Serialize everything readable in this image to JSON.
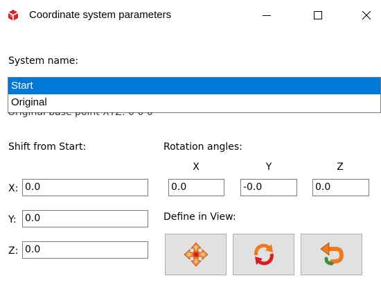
{
  "titlebar": {
    "title": "Coordinate system parameters",
    "app_icon": "sketchup-icon",
    "controls": [
      "minimize-icon",
      "maximize-icon",
      "close-icon"
    ]
  },
  "system": {
    "label": "System name:",
    "options": [
      "Start",
      "Original"
    ],
    "selected": "Start"
  },
  "base_point_label": "Original base point XYZ: 0 0 0",
  "shift": {
    "label": "Shift from Start:",
    "x_label": "X:",
    "x_value": "0.0",
    "y_label": "Y:",
    "y_value": "0.0",
    "z_label": "Z:",
    "z_value": "0.0"
  },
  "rotation": {
    "label": "Rotation angles:",
    "x_head": "X",
    "y_head": "Y",
    "z_head": "Z",
    "x_value": "0.0",
    "y_value": "-0.0",
    "z_value": "0.0"
  },
  "define": {
    "label": "Define in View:",
    "buttons": [
      "move-arrows-icon",
      "rotate-arrows-icon",
      "undo-arrow-icon"
    ]
  },
  "colors": {
    "selection": "#0078d7",
    "icon_orange": "#f07a1a",
    "icon_red": "#d81e1e",
    "icon_green": "#3f8f3a",
    "button_face": "#e1e1e1"
  }
}
